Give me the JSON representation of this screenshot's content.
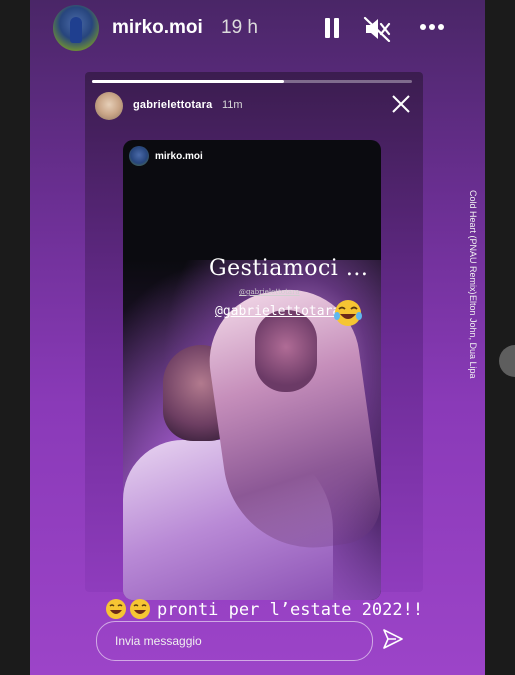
{
  "header": {
    "username": "mirko.moi",
    "time": "19 h"
  },
  "reposted": {
    "username": "gabrielettotara",
    "time": "11m",
    "progress": 0.6
  },
  "story": {
    "owner": "mirko.moi",
    "headline": "Gestiamoci ...",
    "tag_small": "@gabrielettotara",
    "tag_main": "@gabrielettotara"
  },
  "music": {
    "title": "Cold Heart (PNAU Remix)",
    "artist": "Elton John, Dua Lipa"
  },
  "caption": {
    "text": "pronti per l’estate 2022!!"
  },
  "reply": {
    "placeholder": "Invia messaggio"
  },
  "icons": {
    "pause": "pause-icon",
    "mute": "mute-icon",
    "more": "more-icon",
    "close": "close-icon",
    "send": "send-icon",
    "emoji": "laughing-emoji-icon"
  },
  "colors": {
    "background": "#8a3ab8",
    "text": "#ffffff"
  }
}
